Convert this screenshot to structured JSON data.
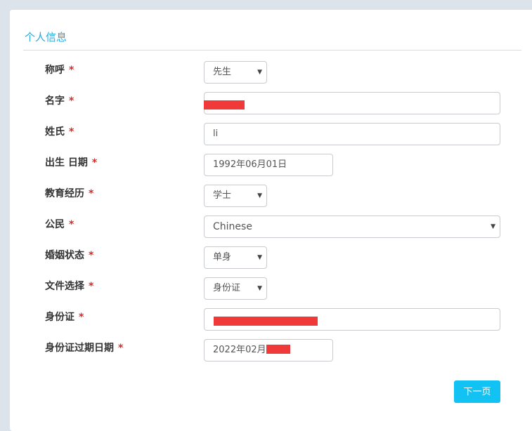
{
  "section_title": "个人信息",
  "required_mark": "*",
  "fields": {
    "title": {
      "label": "称呼",
      "value": "先生"
    },
    "first_name": {
      "label": "名字",
      "value": ""
    },
    "last_name": {
      "label": "姓氏",
      "value": "li"
    },
    "birth_date": {
      "label": "出生 日期",
      "value": "1992年06月01日"
    },
    "education": {
      "label": "教育经历",
      "value": "学士"
    },
    "citizenship": {
      "label": "公民",
      "value": "Chinese"
    },
    "marital_status": {
      "label": "婚姻状态",
      "value": "单身"
    },
    "document_type": {
      "label": "文件选择",
      "value": "身份证"
    },
    "id_number": {
      "label": "身份证",
      "value": ""
    },
    "id_expiry": {
      "label": "身份证过期日期",
      "value": "2022年02月"
    }
  },
  "next_button": "下一页",
  "colors": {
    "accent": "#2aa9dc",
    "button": "#12c2f2",
    "required": "#e02424",
    "redaction": "#f03a3a"
  },
  "icons": {
    "select_caret": "caret-down-icon"
  }
}
